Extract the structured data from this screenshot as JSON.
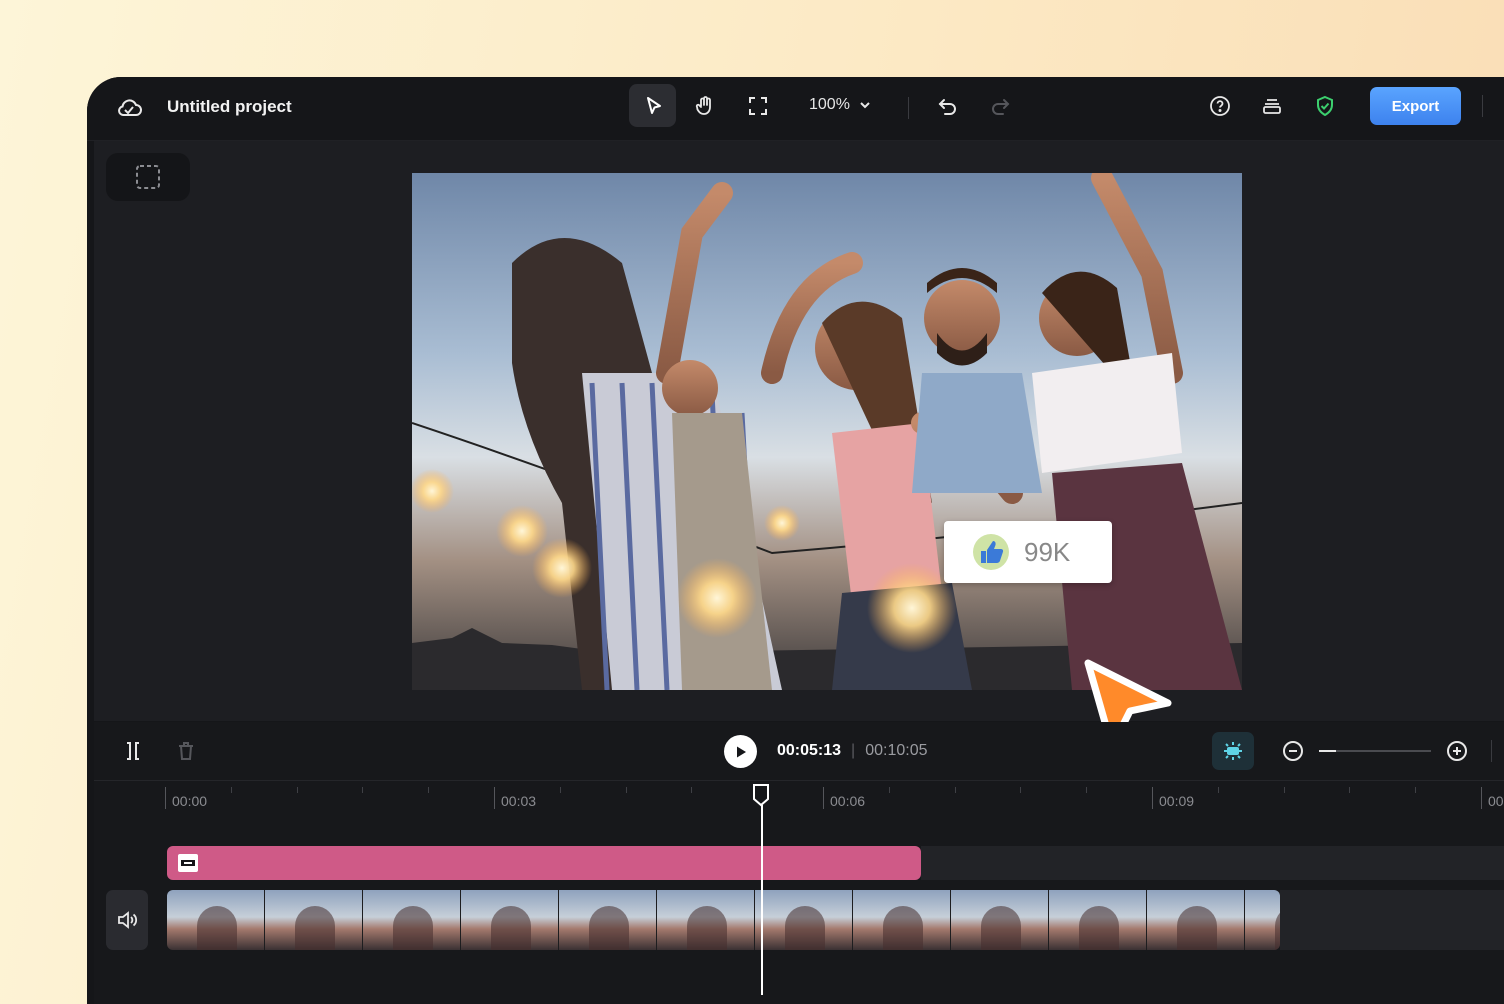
{
  "header": {
    "project_title": "Untitled project",
    "zoom_value": "100%",
    "export_label": "Export"
  },
  "overlay": {
    "like_count": "99K"
  },
  "playback": {
    "current_time": "00:05:13",
    "total_time": "00:10:05",
    "zoom_level": 0.15
  },
  "ruler": {
    "labels": [
      "00:00",
      "00:03",
      "00:06",
      "00:09",
      "00"
    ]
  },
  "colors": {
    "accent": "#4a90f0",
    "text_track": "#cf5a87",
    "shield": "#3ccf6e",
    "cursor": "#ff8a2a",
    "snap_active": "#5fd3e6"
  },
  "icons": {
    "cloud": "cloud-icon",
    "select": "pointer-icon",
    "hand": "hand-icon",
    "fullscreen": "fullscreen-icon",
    "undo": "undo-icon",
    "redo": "redo-icon",
    "help": "help-icon",
    "layers": "layers-icon",
    "shield": "shield-check-icon",
    "split": "split-icon",
    "delete": "trash-icon",
    "play": "play-icon",
    "snap": "snap-icon",
    "zoom_out": "zoom-out-icon",
    "zoom_in": "zoom-in-icon",
    "audio": "speaker-icon"
  }
}
